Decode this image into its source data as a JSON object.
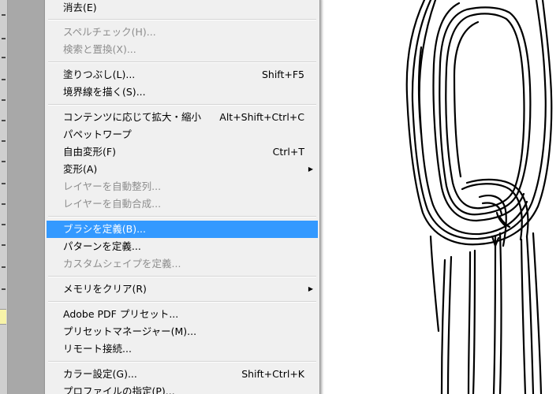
{
  "menu": {
    "items": [
      {
        "label": "消去(E)",
        "shortcut": "",
        "submenu": false,
        "disabled": false,
        "highlighted": false
      },
      {
        "label": "スペルチェック(H)...",
        "shortcut": "",
        "submenu": false,
        "disabled": true,
        "highlighted": false
      },
      {
        "label": "検索と置換(X)...",
        "shortcut": "",
        "submenu": false,
        "disabled": true,
        "highlighted": false
      },
      {
        "label": "塗りつぶし(L)...",
        "shortcut": "Shift+F5",
        "submenu": false,
        "disabled": false,
        "highlighted": false
      },
      {
        "label": "境界線を描く(S)...",
        "shortcut": "",
        "submenu": false,
        "disabled": false,
        "highlighted": false
      },
      {
        "label": "コンテンツに応じて拡大・縮小",
        "shortcut": "Alt+Shift+Ctrl+C",
        "submenu": false,
        "disabled": false,
        "highlighted": false
      },
      {
        "label": "パペットワープ",
        "shortcut": "",
        "submenu": false,
        "disabled": false,
        "highlighted": false
      },
      {
        "label": "自由変形(F)",
        "shortcut": "Ctrl+T",
        "submenu": false,
        "disabled": false,
        "highlighted": false
      },
      {
        "label": "変形(A)",
        "shortcut": "",
        "submenu": true,
        "disabled": false,
        "highlighted": false
      },
      {
        "label": "レイヤーを自動整列...",
        "shortcut": "",
        "submenu": false,
        "disabled": true,
        "highlighted": false
      },
      {
        "label": "レイヤーを自動合成...",
        "shortcut": "",
        "submenu": false,
        "disabled": true,
        "highlighted": false
      },
      {
        "label": "ブラシを定義(B)...",
        "shortcut": "",
        "submenu": false,
        "disabled": false,
        "highlighted": true
      },
      {
        "label": "パターンを定義...",
        "shortcut": "",
        "submenu": false,
        "disabled": false,
        "highlighted": false
      },
      {
        "label": "カスタムシェイプを定義...",
        "shortcut": "",
        "submenu": false,
        "disabled": true,
        "highlighted": false
      },
      {
        "label": "メモリをクリア(R)",
        "shortcut": "",
        "submenu": true,
        "disabled": false,
        "highlighted": false
      },
      {
        "label": "Adobe PDF プリセット...",
        "shortcut": "",
        "submenu": false,
        "disabled": false,
        "highlighted": false
      },
      {
        "label": "プリセットマネージャー(M)...",
        "shortcut": "",
        "submenu": false,
        "disabled": false,
        "highlighted": false
      },
      {
        "label": "リモート接続...",
        "shortcut": "",
        "submenu": false,
        "disabled": false,
        "highlighted": false
      },
      {
        "label": "カラー設定(G)...",
        "shortcut": "Shift+Ctrl+K",
        "submenu": false,
        "disabled": false,
        "highlighted": false
      },
      {
        "label": "プロファイルの指定(P)...",
        "shortcut": "",
        "submenu": false,
        "disabled": false,
        "highlighted": false
      }
    ],
    "submenu_arrow_icon": "triangle-right-icon",
    "highlight_color": "#3399ff",
    "disabled_color": "#8d8d8d"
  }
}
